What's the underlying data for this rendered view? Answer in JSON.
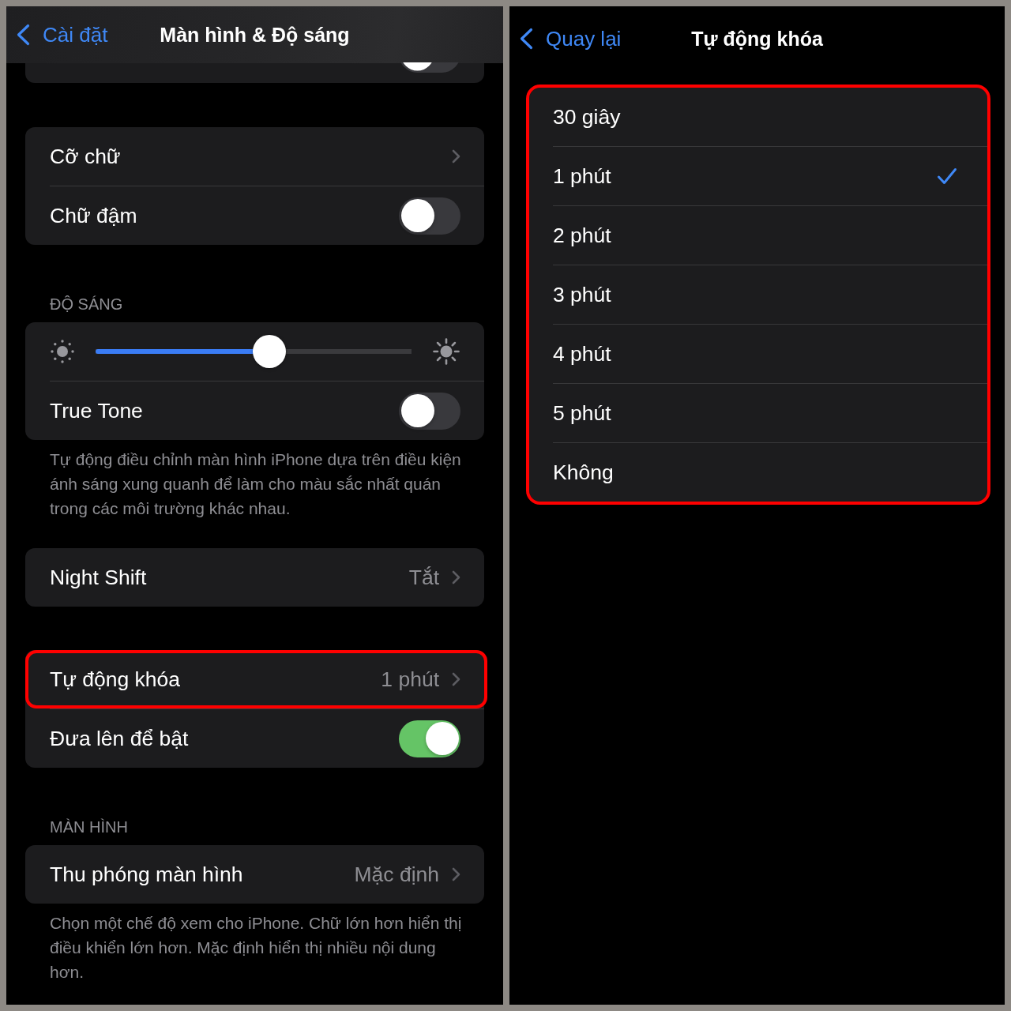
{
  "settings_screen": {
    "nav_bar": {
      "back_label": "Cài đặt",
      "title": "Màn hình & Độ sáng"
    },
    "partial_group": {
      "toggle_on": false
    },
    "sections": [
      {
        "rows": [
          {
            "kind": "link",
            "label": "Cỡ chữ",
            "highlighted": false
          },
          {
            "kind": "toggle",
            "label": "Chữ đậm",
            "on": false
          }
        ]
      },
      {
        "header": "ĐỘ SÁNG",
        "rows": [
          {
            "kind": "slider",
            "level": 0.55
          },
          {
            "kind": "toggle",
            "label": "True Tone",
            "on": false
          }
        ],
        "footer": "Tự động điều chỉnh màn hình iPhone dựa trên điều kiện ánh sáng xung quanh để làm cho màu sắc nhất quán trong các môi trường khác nhau."
      },
      {
        "rows": [
          {
            "kind": "link",
            "label": "Night Shift",
            "value": "Tắt",
            "highlighted": false
          }
        ]
      },
      {
        "rows": [
          {
            "kind": "link",
            "label": "Tự động khóa",
            "value": "1 phút",
            "highlighted": true
          },
          {
            "kind": "toggle",
            "label": "Đưa lên để bật",
            "on": true
          }
        ]
      },
      {
        "header": "MÀN HÌNH",
        "rows": [
          {
            "kind": "link",
            "label": "Thu phóng màn hình",
            "value": "Mặc định",
            "highlighted": false
          }
        ],
        "footer": "Chọn một chế độ xem cho iPhone. Chữ lớn hơn hiển thị điều khiển lớn hơn. Mặc định hiển thị nhiều nội dung hơn."
      }
    ]
  },
  "auto_lock_screen": {
    "nav_bar": {
      "back_label": "Quay lại",
      "title": "Tự động khóa"
    },
    "highlighted": true,
    "options": [
      {
        "label": "30 giây",
        "selected": false
      },
      {
        "label": "1 phút",
        "selected": true
      },
      {
        "label": "2 phút",
        "selected": false
      },
      {
        "label": "3 phút",
        "selected": false
      },
      {
        "label": "4 phút",
        "selected": false
      },
      {
        "label": "5 phút",
        "selected": false
      },
      {
        "label": "Không",
        "selected": false
      }
    ]
  }
}
